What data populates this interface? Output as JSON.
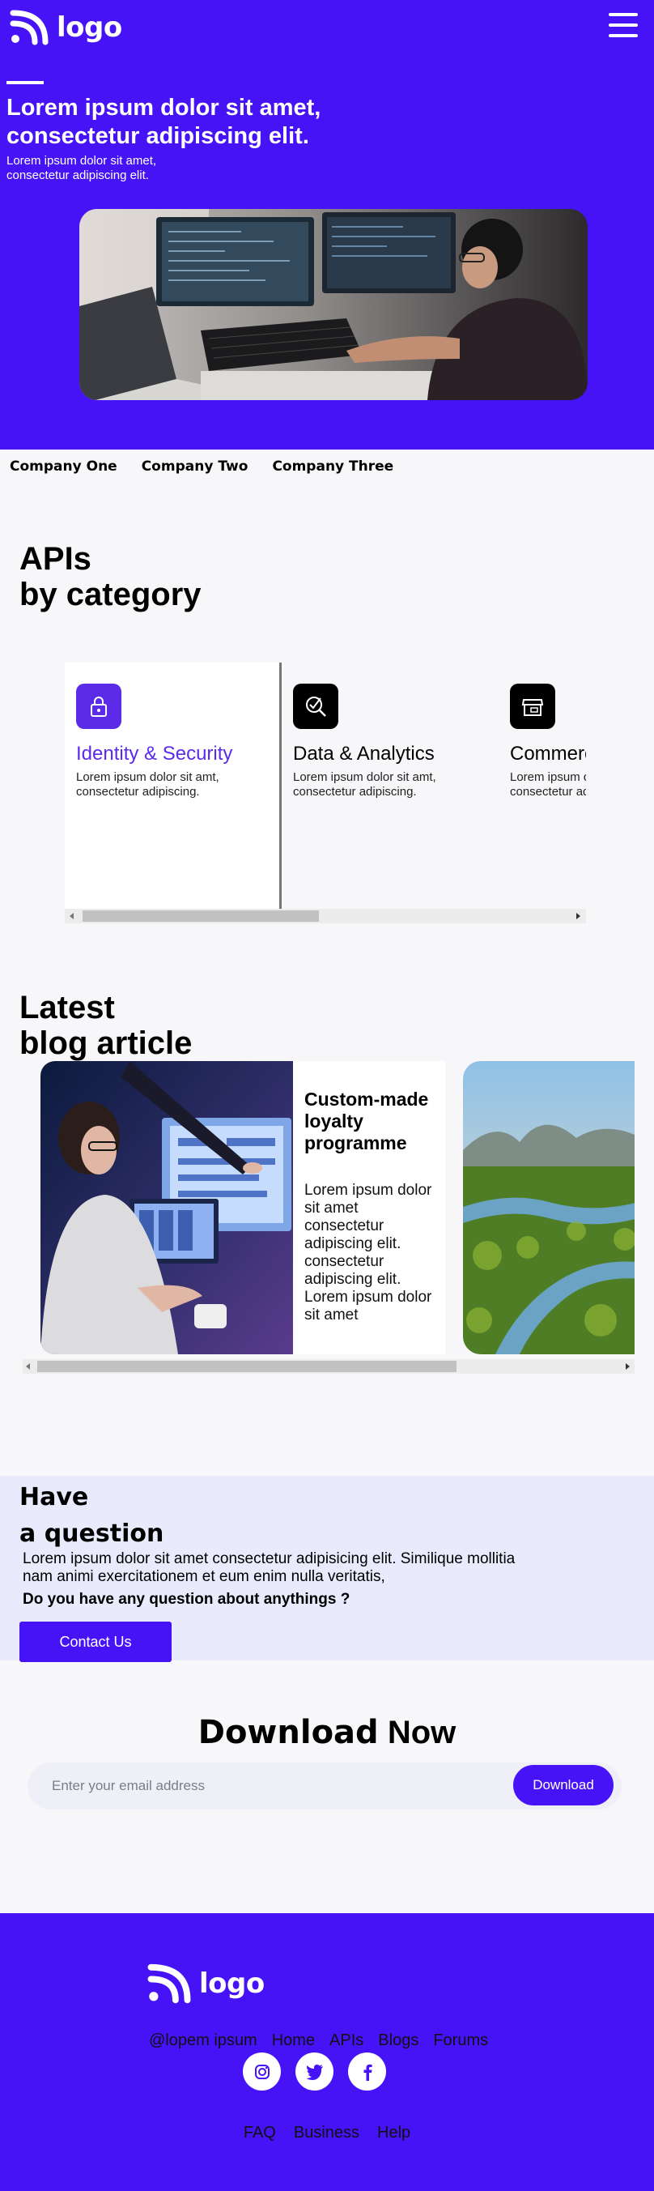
{
  "header": {
    "logo_text": "logo",
    "menu_icon": "hamburger-menu-icon"
  },
  "hero": {
    "title": "Lorem ipsum dolor sit amet, consectetur adipiscing elit.",
    "subtitle": "Lorem ipsum dolor sit amet, consectetur adipiscing elit.",
    "image": "developer-at-computers-photo"
  },
  "companies": [
    "Company One",
    "Company Two",
    "Company Three"
  ],
  "apis": {
    "title_line1": "APIs",
    "title_line2": "by category",
    "cards": [
      {
        "name": "Identity & Security",
        "desc": "Lorem ipsum dolor sit amt, consectetur adipiscing.",
        "icon": "lock-icon",
        "color": "#5b2be8"
      },
      {
        "name": "Data & Analytics",
        "desc": "Lorem ipsum dolor sit amt, consectetur adipiscing.",
        "icon": "analytics-search-icon",
        "color": "#000000"
      },
      {
        "name": "Commerce",
        "desc": "Lorem ipsum dolor sit amt, consectetur adipiscing.",
        "icon": "store-icon",
        "color": "#000000"
      }
    ]
  },
  "blog": {
    "title_line1": "Latest",
    "title_line2": "blog article",
    "article": {
      "heading": "Custom-made loyalty programme",
      "body": "Lorem ipsum dolor sit amet consectetur adipiscing elit. consectetur adipiscing elit. Lorem ipsum dolor sit amet"
    }
  },
  "question": {
    "title_line1": "Have",
    "title_line2": "a question",
    "text": "Lorem ipsum dolor sit amet consectetur adipisicing elit. Similique mollitia nam animi exercitationem et eum enim nulla veritatis,",
    "ask": "Do you have any question about anythings ?",
    "button": "Contact Us"
  },
  "download": {
    "title_bold": "Download",
    "title_light": "Now",
    "placeholder": "Enter your email address",
    "button": "Download"
  },
  "footer": {
    "logo_text": "logo",
    "links": [
      "@lopem ipsum",
      "Home",
      "APIs",
      "Blogs",
      "Forums"
    ],
    "social": [
      "instagram-icon",
      "twitter-icon",
      "facebook-icon"
    ],
    "bottom_links": [
      "FAQ",
      "Business",
      "Help"
    ]
  },
  "colors": {
    "brand": "#4613f6",
    "question_bg": "#e9ebfd",
    "page_bg": "#f7f7fa"
  }
}
